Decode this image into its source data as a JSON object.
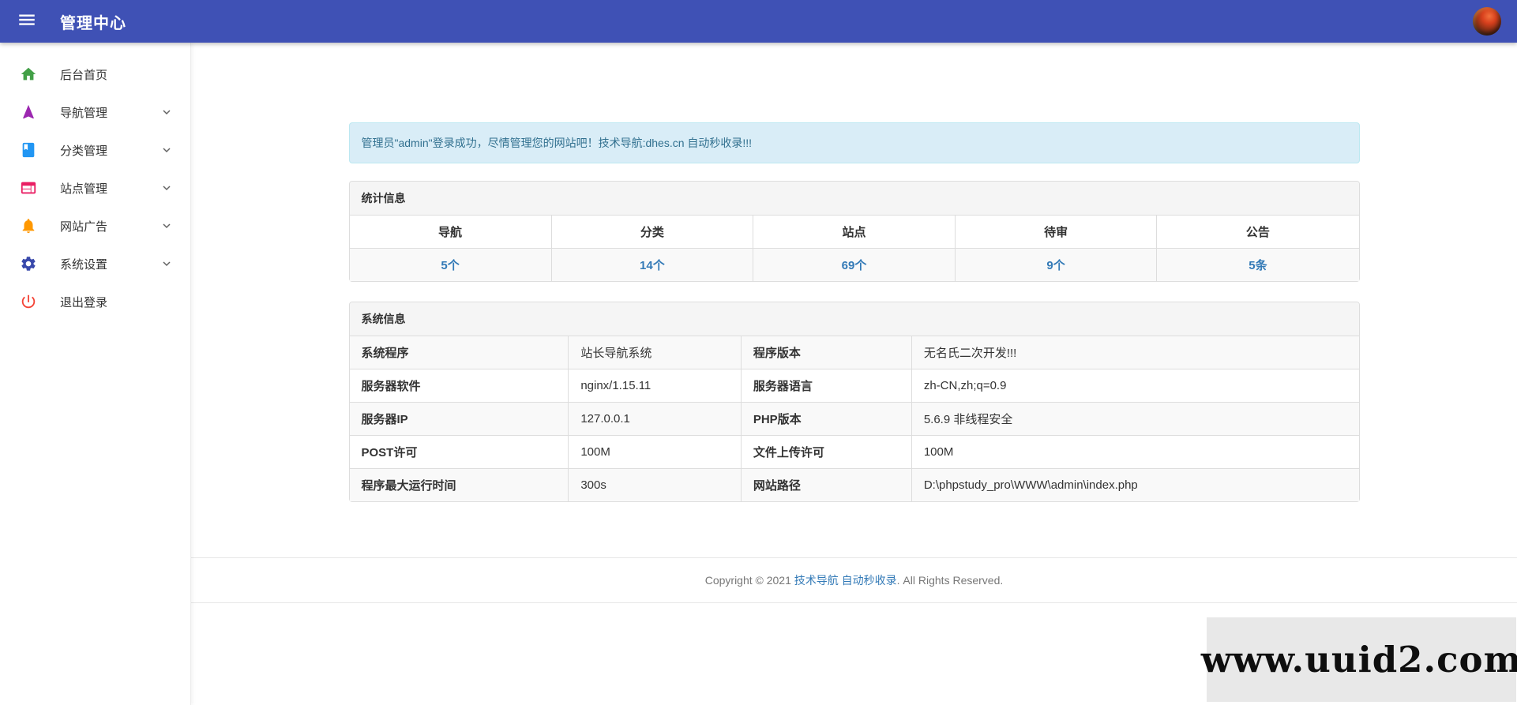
{
  "topbar": {
    "title": "管理中心"
  },
  "sidebar": {
    "items": [
      {
        "label": "后台首页",
        "icon": "home-icon",
        "expandable": false
      },
      {
        "label": "导航管理",
        "icon": "navigation-icon",
        "expandable": true
      },
      {
        "label": "分类管理",
        "icon": "book-icon",
        "expandable": true
      },
      {
        "label": "站点管理",
        "icon": "web-card-icon",
        "expandable": true
      },
      {
        "label": "网站广告",
        "icon": "bell-icon",
        "expandable": true
      },
      {
        "label": "系统设置",
        "icon": "gear-icon",
        "expandable": true
      },
      {
        "label": "退出登录",
        "icon": "power-icon",
        "expandable": false
      }
    ]
  },
  "alert": {
    "text": "管理员\"admin\"登录成功，尽情管理您的网站吧！技术导航:dhes.cn 自动秒收录!!!"
  },
  "stats": {
    "panel_title": "统计信息",
    "columns": [
      "导航",
      "分类",
      "站点",
      "待审",
      "公告"
    ],
    "values": [
      "5个",
      "14个",
      "69个",
      "9个",
      "5条"
    ]
  },
  "system": {
    "panel_title": "系统信息",
    "rows": [
      {
        "l1": "系统程序",
        "v1": "站长导航系统",
        "l2": "程序版本",
        "v2": "无名氏二次开发!!!"
      },
      {
        "l1": "服务器软件",
        "v1": "nginx/1.15.11",
        "l2": "服务器语言",
        "v2": "zh-CN,zh;q=0.9"
      },
      {
        "l1": "服务器IP",
        "v1": "127.0.0.1",
        "l2": "PHP版本",
        "v2": "5.6.9 非线程安全"
      },
      {
        "l1": "POST许可",
        "v1": "100M",
        "l2": "文件上传许可",
        "v2": "100M"
      },
      {
        "l1": "程序最大运行时间",
        "v1": "300s",
        "l2": "网站路径",
        "v2": "D:\\phpstudy_pro\\WWW\\admin\\index.php"
      }
    ]
  },
  "footer": {
    "prefix": "Copyright © 2021 ",
    "link": "技术导航 自动秒收录",
    "suffix": ". All Rights Reserved."
  },
  "watermark": {
    "text": "www.uuid2.com"
  },
  "colors": {
    "topbar": "#3f51b5",
    "link": "#337ab7",
    "alert_bg": "#d9edf7",
    "alert_text": "#31708f",
    "home_icon": "#43a047",
    "navigation_icon": "#9c27b0",
    "book_icon": "#2196f3",
    "web_card_icon": "#e91e63",
    "bell_icon": "#ff9800",
    "gear_icon": "#3949ab",
    "power_icon": "#f44336",
    "watermark_bg": "#e8e8e8"
  }
}
